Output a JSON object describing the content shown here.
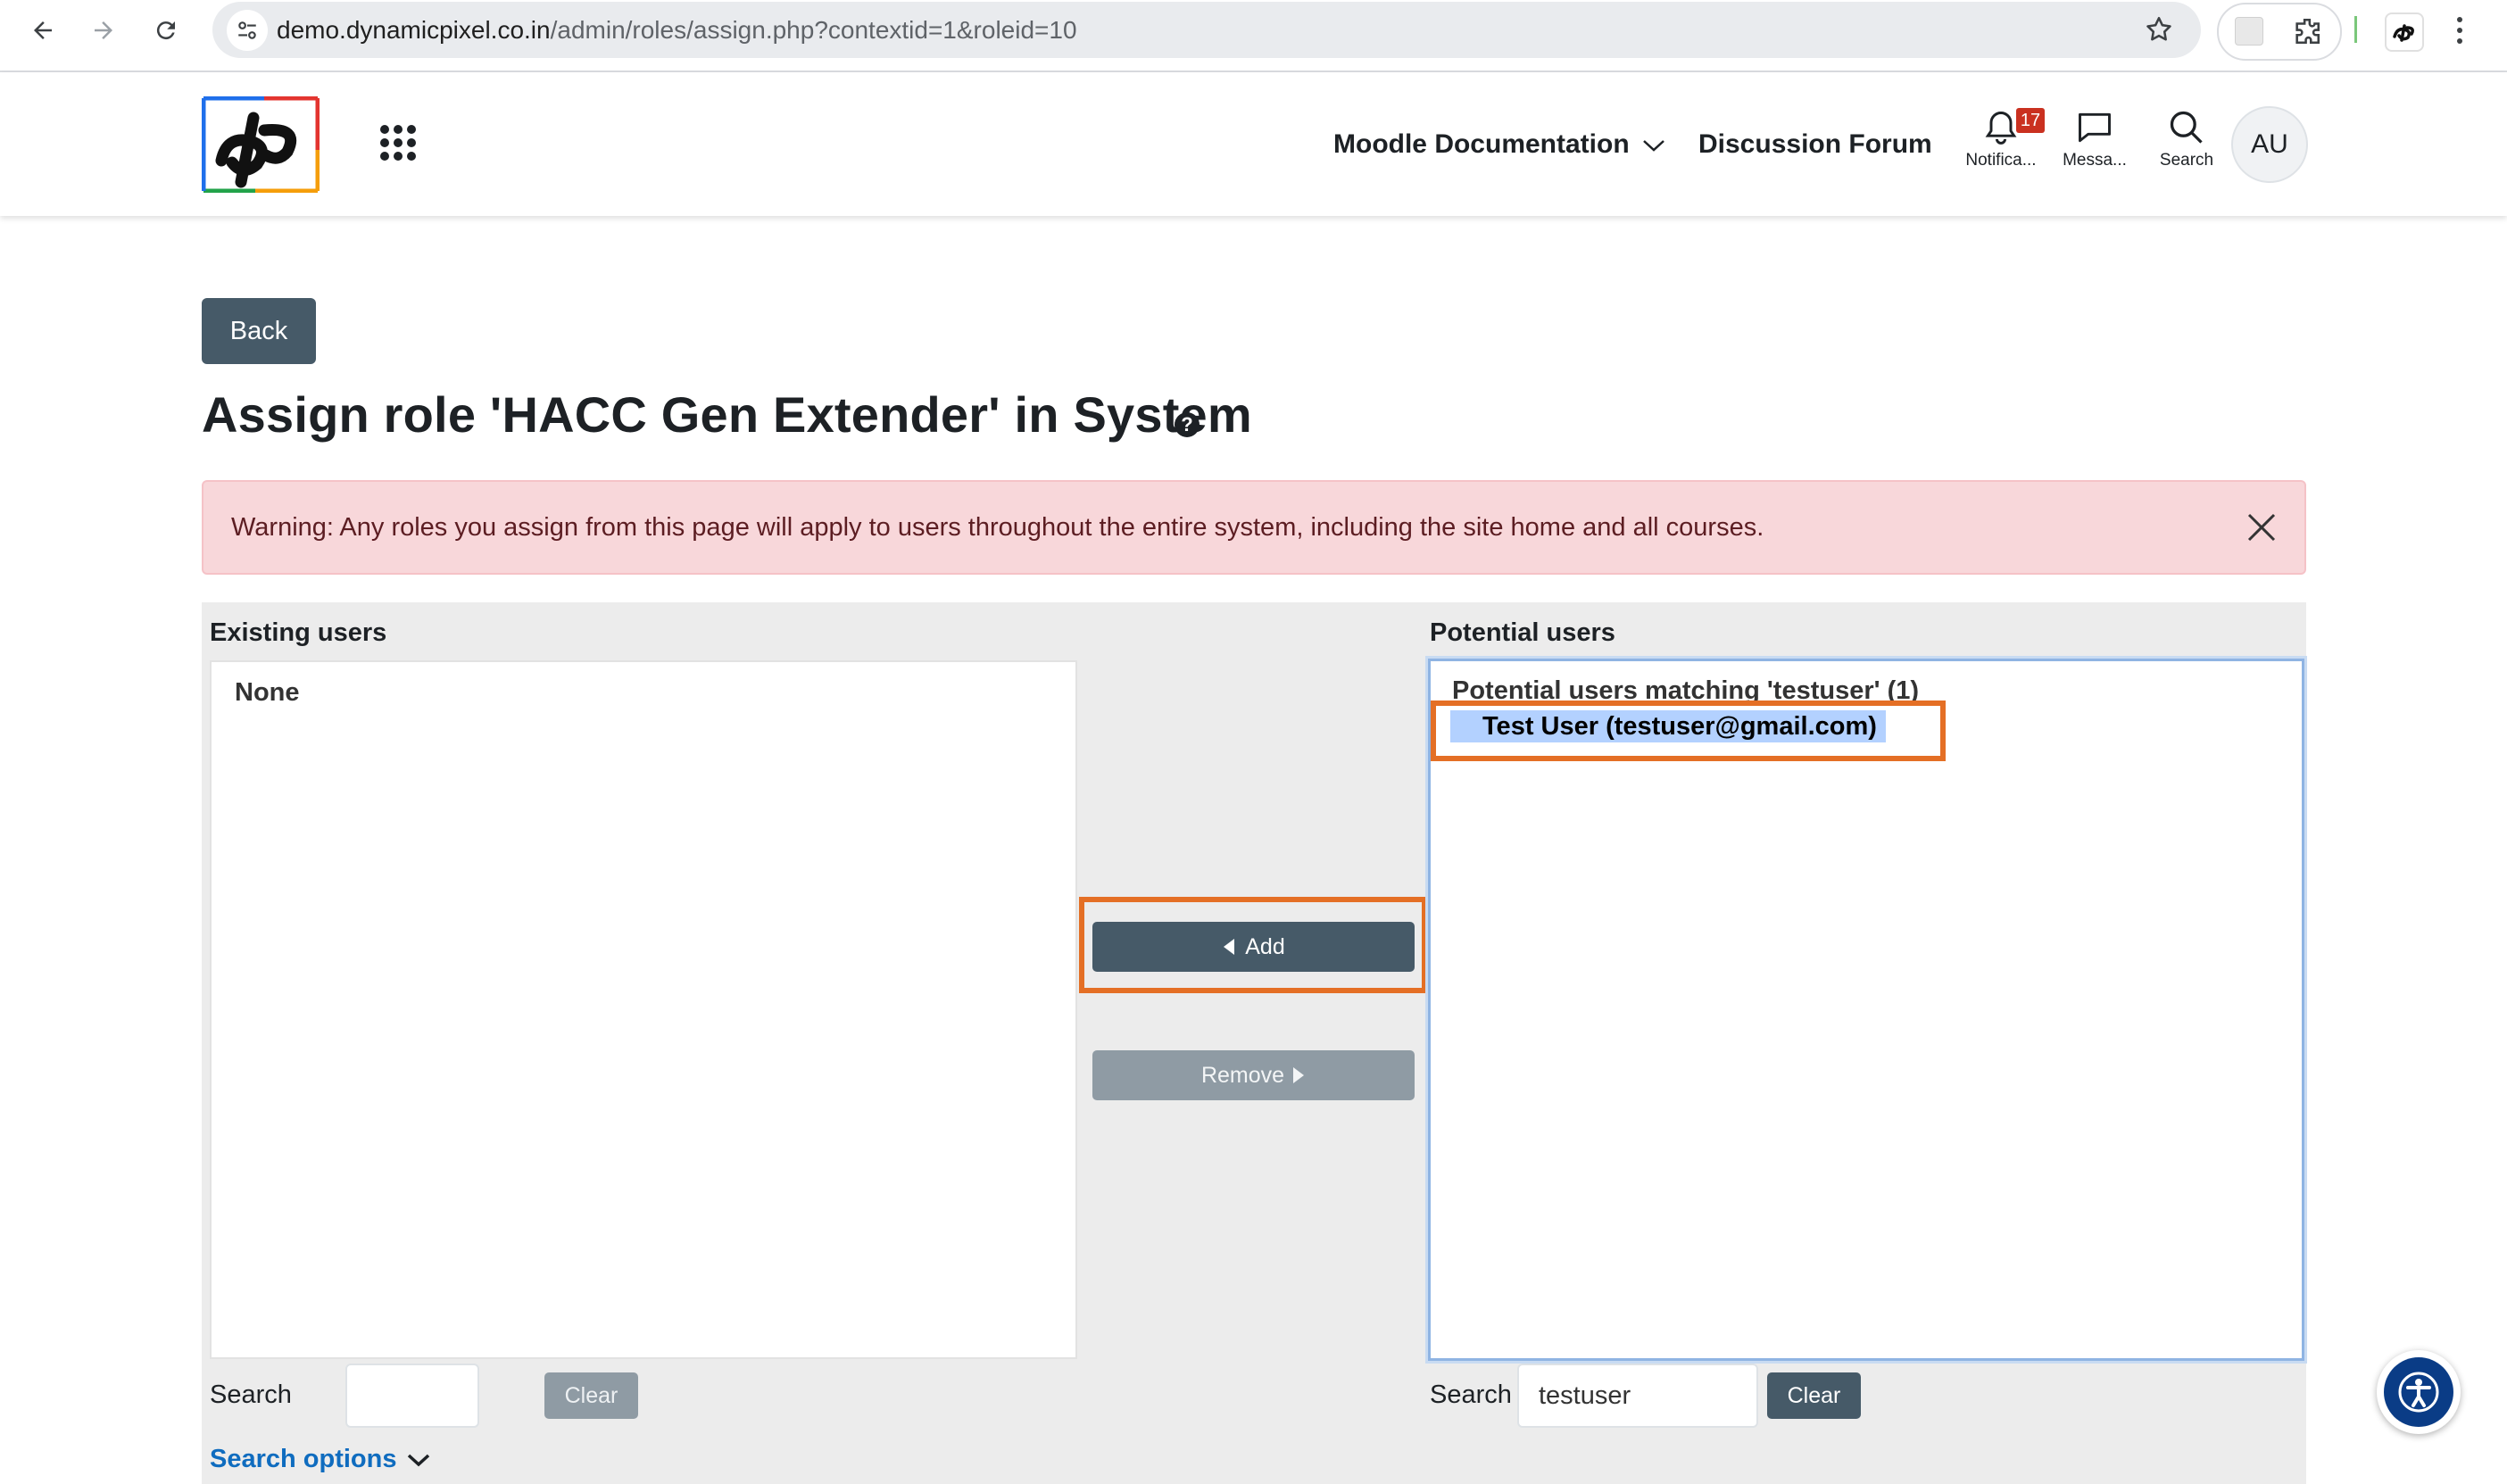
{
  "browser": {
    "url_host": "demo.dynamicpixel.co.in",
    "url_path": "/admin/roles/assign.php?contextid=1&roleid=10"
  },
  "topnav": {
    "doc_label": "Moodle Documentation",
    "forum_label": "Discussion Forum",
    "notifications_label": "Notifica...",
    "notifications_count": "17",
    "messages_label": "Messa...",
    "search_label": "Search",
    "avatar_initials": "AU"
  },
  "page": {
    "back_label": "Back",
    "title": "Assign role 'HACC Gen Extender' in System",
    "help_glyph": "?",
    "warning": "Warning: Any roles you assign from this page will apply to users throughout the entire system, including the site home and all courses."
  },
  "existing": {
    "label": "Existing users",
    "empty_text": "None",
    "search_label": "Search",
    "search_value": "",
    "clear_label": "Clear",
    "search_options_label": "Search options"
  },
  "buttons": {
    "add_label": "Add",
    "remove_label": "Remove"
  },
  "potential": {
    "label": "Potential users",
    "group_label": "Potential users matching 'testuser' (1)",
    "selected_option": "Test User (testuser@gmail.com)",
    "search_label": "Search",
    "search_value": "testuser",
    "clear_label": "Clear"
  },
  "colors": {
    "primary_button": "#465a68",
    "highlight_box": "#e46f25",
    "alert_bg": "#f8d7da",
    "link": "#0f6cbf",
    "notification_badge": "#ca3120"
  },
  "icons": [
    "back-arrow-icon",
    "forward-arrow-icon",
    "reload-icon",
    "site-info-icon",
    "star-icon",
    "extensions-icon",
    "menu-kebab-icon",
    "app-grid-icon",
    "chevron-down-icon",
    "bell-icon",
    "chat-icon",
    "search-icon",
    "close-icon",
    "caret-left-icon",
    "caret-right-icon",
    "accessibility-icon"
  ]
}
